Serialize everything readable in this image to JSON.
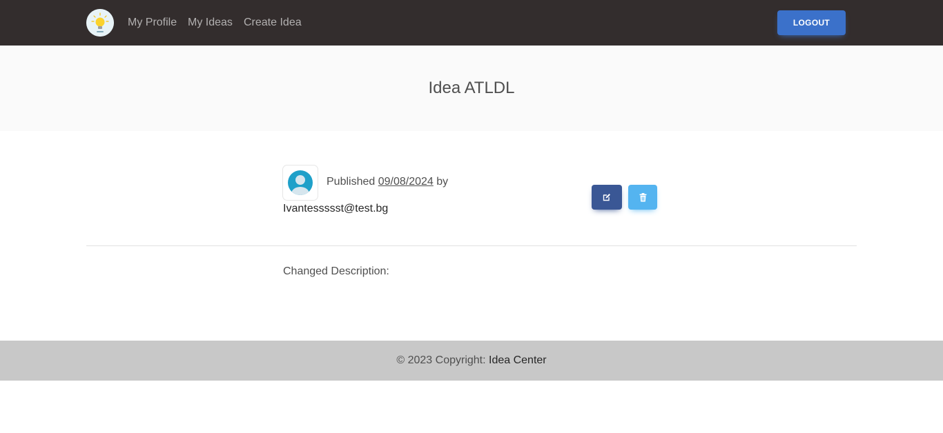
{
  "nav": {
    "links": [
      "My Profile",
      "My Ideas",
      "Create Idea"
    ],
    "logout_label": "LOGOUT"
  },
  "idea": {
    "title": "Idea ATLDL",
    "published_prefix": "Published",
    "published_date": "09/08/2024",
    "published_suffix": "by",
    "author": "Ivantessssst@test.bg",
    "description": "Changed Description:"
  },
  "footer": {
    "prefix": "© 2023 Copyright: ",
    "brand": "Idea Center"
  },
  "colors": {
    "navbar": "#332d2d",
    "logout": "#3b71ca",
    "edit": "#3a5795",
    "delete": "#54b4f0",
    "footer": "#c8c8c8"
  },
  "icons": {
    "logo": "lightbulb-icon",
    "avatar": "user-avatar-icon",
    "edit": "edit-icon",
    "delete": "trash-icon"
  }
}
